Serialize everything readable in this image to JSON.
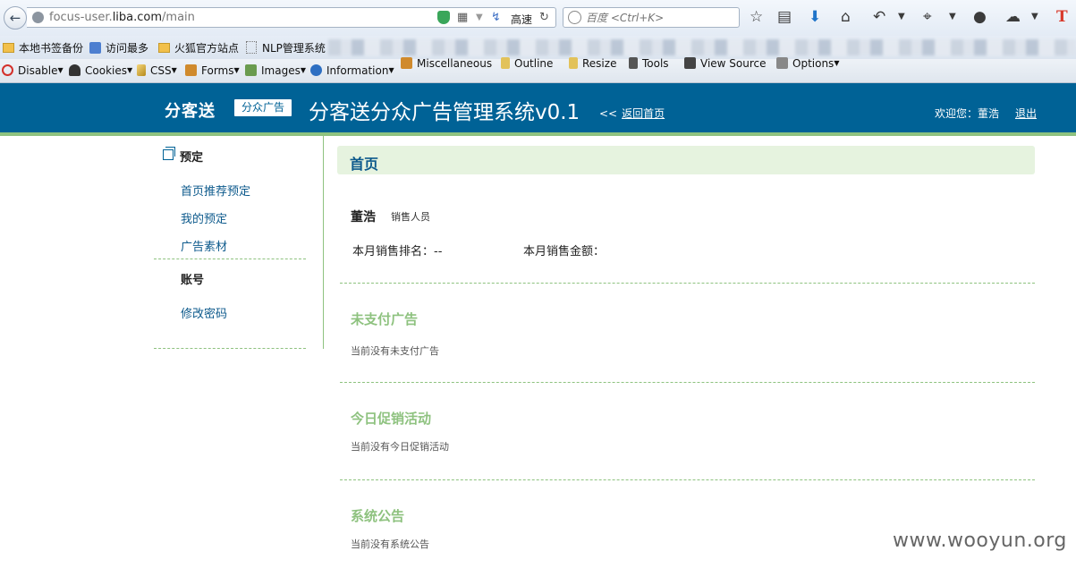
{
  "browser": {
    "url_host": "focus-user.",
    "url_domain": "liba.com",
    "url_path": "/main",
    "speed_label": "高速",
    "search_placeholder": "百度 <Ctrl+K>",
    "bookmarks": [
      "本地书签备份",
      "访问最多",
      "火狐官方站点",
      "NLP管理系统"
    ],
    "devtools": [
      "Disable",
      "Cookies",
      "CSS",
      "Forms",
      "Images",
      "Information",
      "Miscellaneous",
      "Outline",
      "Resize",
      "Tools",
      "View Source",
      "Options"
    ]
  },
  "header": {
    "brand": "分客送",
    "badge": "分众广告",
    "title": "分客送分众广告管理系统v0.1",
    "back_home_chevron": "<<",
    "back_home": "返回首页",
    "welcome": "欢迎您：董浩",
    "logout": "退出"
  },
  "sidebar": {
    "reserve_heading": "预定",
    "reserve_items": [
      "首页推荐预定",
      "我的预定",
      "广告素材"
    ],
    "account_heading": "账号",
    "account_items": [
      "修改密码"
    ]
  },
  "main": {
    "page_title": "首页",
    "user_name": "董浩",
    "user_role": "销售人员",
    "rank_label": "本月销售排名：--",
    "amount_label": "本月销售金额：",
    "sections": [
      {
        "title": "未支付广告",
        "empty": "当前没有未支付广告"
      },
      {
        "title": "今日促销活动",
        "empty": "当前没有今日促销活动"
      },
      {
        "title": "系统公告",
        "empty": "当前没有系统公告"
      }
    ]
  },
  "watermark": "www.wooyun.org",
  "colors": {
    "header_bg": "#006296",
    "accent_green": "#8ec27f",
    "title_bar_bg": "#e6f3df",
    "link_blue": "#0d5a8c"
  }
}
